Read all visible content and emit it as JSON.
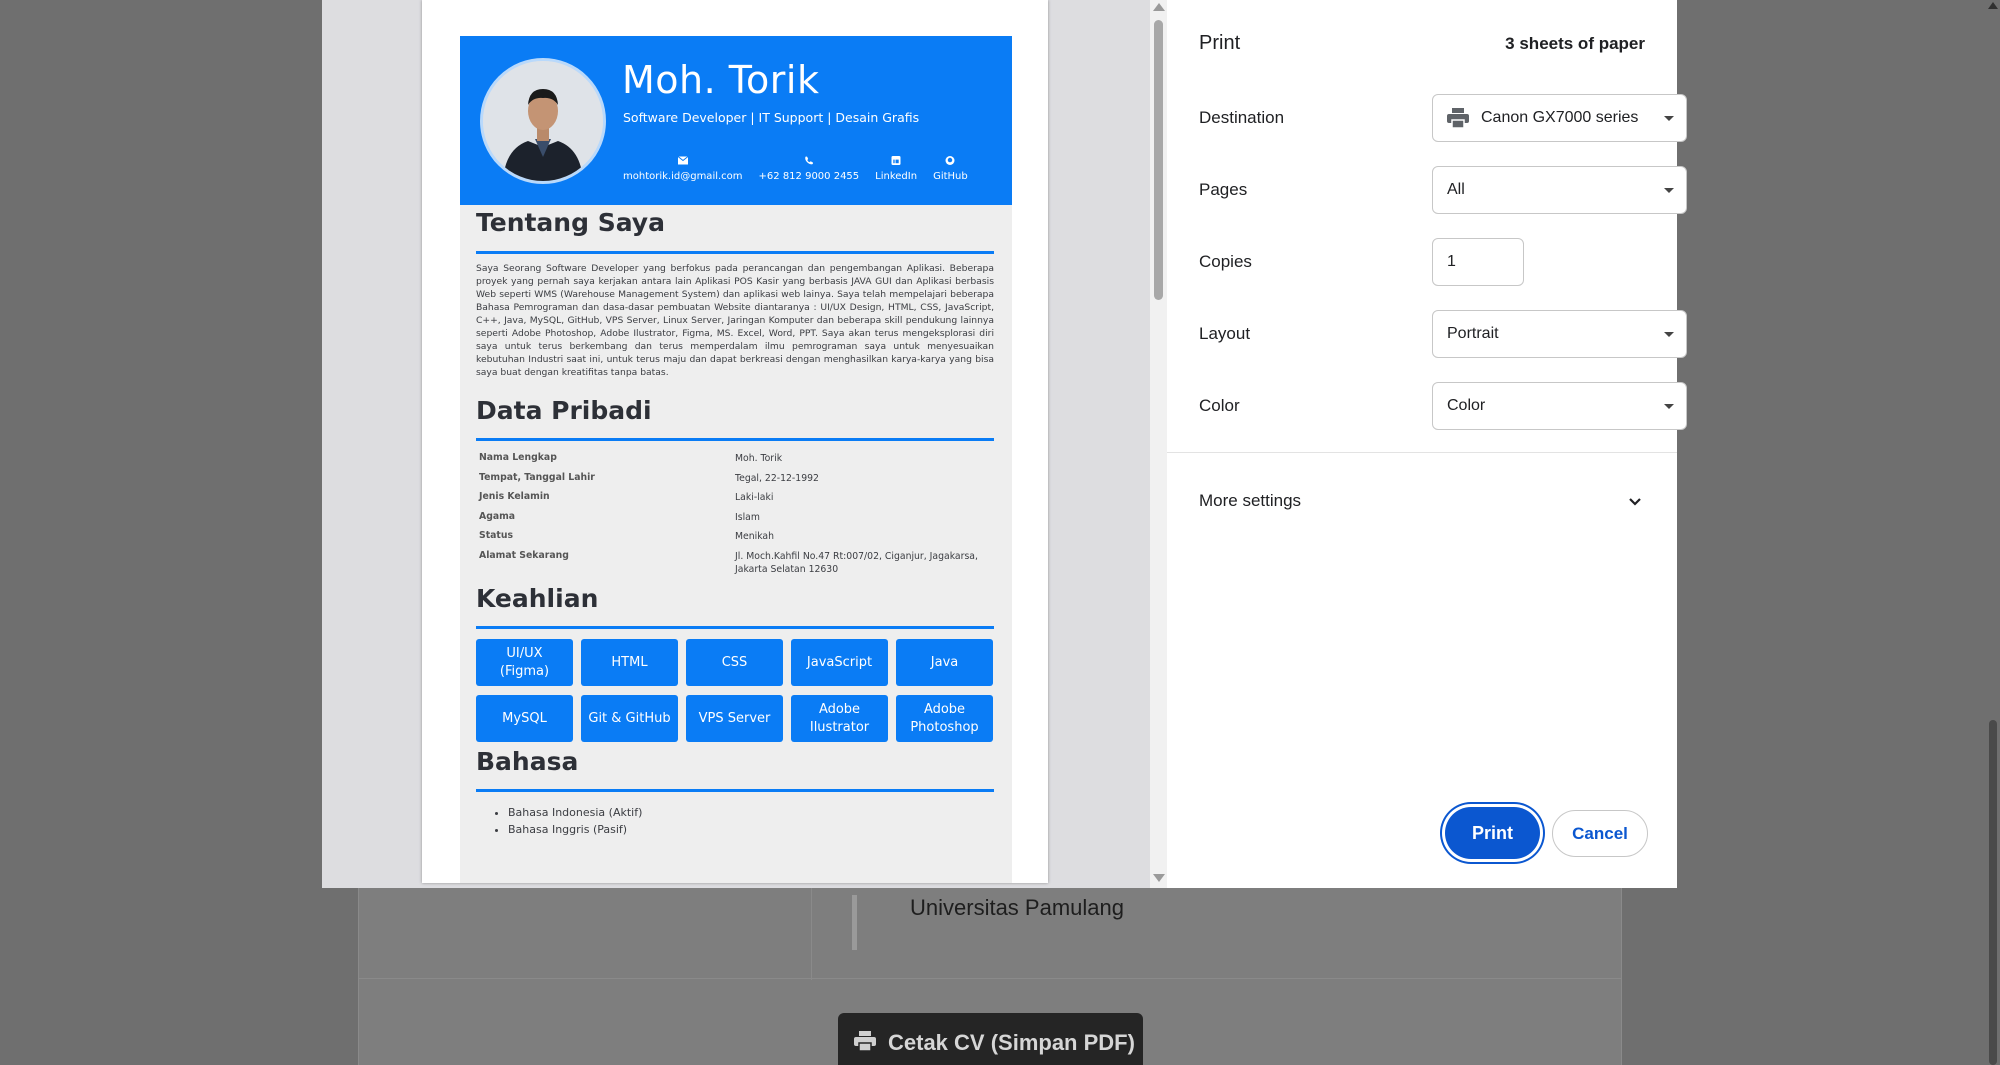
{
  "background": {
    "university": "Universitas Pamulang",
    "print_cv_button": "Cetak CV (Simpan PDF)"
  },
  "dialog": {
    "title": "Print",
    "sheets": "3 sheets of paper",
    "destination": {
      "label": "Destination",
      "value": "Canon GX7000 series"
    },
    "pages": {
      "label": "Pages",
      "value": "All"
    },
    "copies": {
      "label": "Copies",
      "value": "1"
    },
    "layout": {
      "label": "Layout",
      "value": "Portrait"
    },
    "color": {
      "label": "Color",
      "value": "Color"
    },
    "more_settings": "More settings",
    "print_button": "Print",
    "cancel_button": "Cancel",
    "accent_color": "#0b57d0"
  },
  "cv": {
    "accent_color": "#0a7cf5",
    "name": "Moh. Torik",
    "subtitle": "Software Developer | IT Support | Desain Grafis",
    "contacts": [
      {
        "icon": "envelope-icon",
        "label": "mohtorik.id@gmail.com"
      },
      {
        "icon": "phone-icon",
        "label": "+62 812 9000 2455"
      },
      {
        "icon": "linkedin-icon",
        "label": "LinkedIn"
      },
      {
        "icon": "github-icon",
        "label": "GitHub"
      }
    ],
    "about_title": "Tentang Saya",
    "about_text": "Saya Seorang Software Developer yang berfokus pada perancangan dan pengembangan Aplikasi. Beberapa proyek yang pernah saya kerjakan antara lain Aplikasi POS Kasir yang berbasis JAVA GUI dan Aplikasi berbasis Web seperti WMS (Warehouse Management System) dan aplikasi web lainya. Saya telah mempelajari beberapa Bahasa Pemrograman dan dasa-dasar pembuatan Website diantaranya : UI/UX Design, HTML, CSS, JavaScript, C++, Java, MySQL, GitHub, VPS Server, Linux Server, Jaringan Komputer dan beberapa skill pendukung lainnya seperti Adobe Photoshop, Adobe Ilustrator, Figma, MS. Excel, Word, PPT. Saya akan terus mengeksplorasi diri saya untuk terus berkembang dan terus memperdalam ilmu pemrograman saya untuk menyesuaikan kebutuhan Industri saat ini, untuk terus maju dan dapat berkreasi dengan menghasilkan karya-karya yang bisa saya buat dengan kreatifitas tanpa batas.",
    "data_title": "Data Pribadi",
    "data": [
      {
        "key": "Nama Lengkap",
        "value": "Moh. Torik"
      },
      {
        "key": "Tempat, Tanggal Lahir",
        "value": "Tegal, 22-12-1992"
      },
      {
        "key": "Jenis Kelamin",
        "value": "Laki-laki"
      },
      {
        "key": "Agama",
        "value": "Islam"
      },
      {
        "key": "Status",
        "value": "Menikah"
      },
      {
        "key": "Alamat Sekarang",
        "value": "Jl. Moch.Kahfil No.47 Rt:007/02, Ciganjur, Jagakarsa, Jakarta Selatan 12630"
      }
    ],
    "skills_title": "Keahlian",
    "skills": [
      "UI/UX (Figma)",
      "HTML",
      "CSS",
      "JavaScript",
      "Java",
      "MySQL",
      "Git & GitHub",
      "VPS Server",
      "Adobe Ilustrator",
      "Adobe Photoshop"
    ],
    "languages_title": "Bahasa",
    "languages": [
      "Bahasa Indonesia (Aktif)",
      "Bahasa Inggris (Pasif)"
    ]
  }
}
